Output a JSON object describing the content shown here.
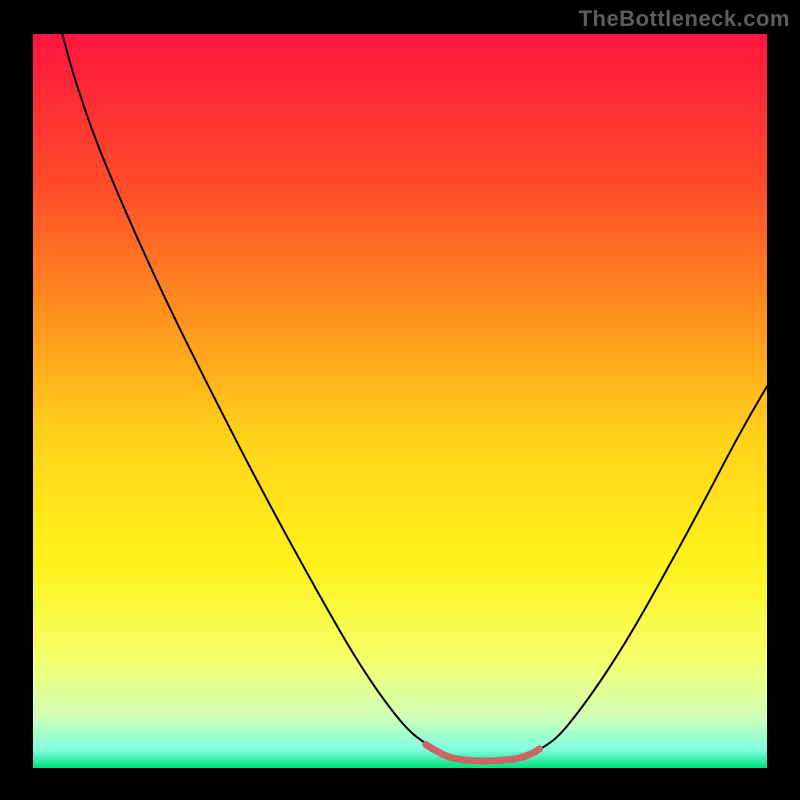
{
  "watermark": "TheBottleneck.com",
  "chart_data": {
    "type": "line",
    "title": "",
    "xlabel": "",
    "ylabel": "",
    "xlim": [
      0,
      100
    ],
    "ylim": [
      0,
      100
    ],
    "gradient_stops": [
      {
        "offset": 0.0,
        "color": "#ff153f"
      },
      {
        "offset": 0.2,
        "color": "#ff4a2a"
      },
      {
        "offset": 0.4,
        "color": "#ff981d"
      },
      {
        "offset": 0.55,
        "color": "#ffd21a"
      },
      {
        "offset": 0.72,
        "color": "#fff21a"
      },
      {
        "offset": 0.85,
        "color": "#f6ff6a"
      },
      {
        "offset": 0.93,
        "color": "#d0ffb8"
      },
      {
        "offset": 0.975,
        "color": "#7fffe0"
      },
      {
        "offset": 1.0,
        "color": "#00e27a"
      }
    ],
    "series": [
      {
        "name": "bottleneck-curve",
        "stroke": "#000000",
        "stroke_width": 2,
        "points": [
          {
            "x": 4.0,
            "y": 100.0
          },
          {
            "x": 6.0,
            "y": 93.0
          },
          {
            "x": 10.0,
            "y": 82.0
          },
          {
            "x": 18.0,
            "y": 64.0
          },
          {
            "x": 28.0,
            "y": 44.0
          },
          {
            "x": 36.0,
            "y": 29.0
          },
          {
            "x": 44.0,
            "y": 15.0
          },
          {
            "x": 50.0,
            "y": 6.5
          },
          {
            "x": 54.0,
            "y": 3.0
          },
          {
            "x": 57.0,
            "y": 1.3
          },
          {
            "x": 62.0,
            "y": 0.9
          },
          {
            "x": 66.0,
            "y": 1.2
          },
          {
            "x": 69.0,
            "y": 2.5
          },
          {
            "x": 73.0,
            "y": 6.0
          },
          {
            "x": 80.0,
            "y": 16.0
          },
          {
            "x": 88.0,
            "y": 30.0
          },
          {
            "x": 96.0,
            "y": 45.0
          },
          {
            "x": 100.0,
            "y": 52.0
          }
        ]
      },
      {
        "name": "optimal-zone",
        "stroke": "#cc6666",
        "stroke_width": 7,
        "points": [
          {
            "x": 53.5,
            "y": 3.2
          },
          {
            "x": 55.0,
            "y": 2.3
          },
          {
            "x": 57.0,
            "y": 1.4
          },
          {
            "x": 60.0,
            "y": 1.0
          },
          {
            "x": 63.0,
            "y": 1.0
          },
          {
            "x": 66.0,
            "y": 1.3
          },
          {
            "x": 68.0,
            "y": 2.0
          },
          {
            "x": 69.0,
            "y": 2.6
          }
        ]
      }
    ]
  }
}
